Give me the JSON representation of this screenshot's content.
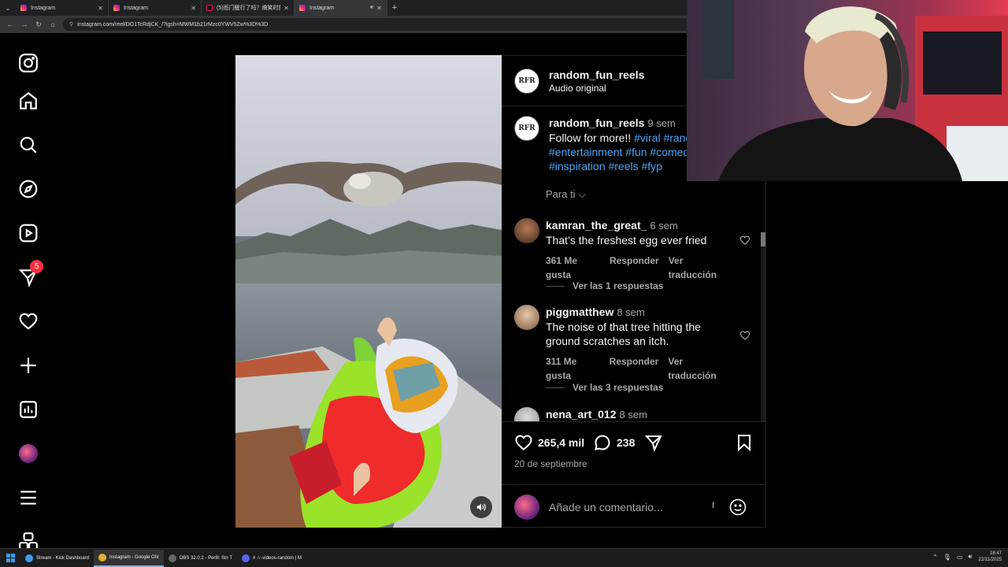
{
  "browser": {
    "tabs": [
      {
        "label": "Instagram",
        "favicon": "instagram-icon",
        "active": false
      },
      {
        "label": "Instagram",
        "favicon": "instagram-icon",
        "active": false
      },
      {
        "label": "(5)而门醒行了吗？搞笑时刻分",
        "favicon": "tiktok-icon",
        "active": false
      },
      {
        "label": "Instagram",
        "favicon": "instagram-icon",
        "active": true
      }
    ],
    "url": "instagram.com/reel/DO1TcRdjCK_/?igsh=MWM1b21rMzc0YWV5Zw%3D%3D"
  },
  "nav": {
    "notification_count": "5",
    "icons": [
      "instagram-logo-icon",
      "home-icon",
      "search-icon",
      "explore-icon",
      "reels-icon",
      "messages-icon",
      "notifications-icon",
      "create-icon",
      "dashboard-icon",
      "profile-avatar",
      "menu-icon",
      "more-apps-icon"
    ]
  },
  "post": {
    "username": "random_fun_reels",
    "audio": "Audio original",
    "avatar_text": "RFR",
    "caption": {
      "username": "random_fun_reels",
      "time": "9 sem",
      "text": "Follow for more!! ",
      "line1_tags": "#viral #rand",
      "line2_tags": "#entertainment #fun #comed",
      "line3_tags": "#inspiration #reels #fyp"
    },
    "sort_label": "Para ti",
    "likes": "265,4 mil",
    "comments_count": "238",
    "date": "20 de septiembre",
    "comment_placeholder": "Añade un comentario..."
  },
  "comments": [
    {
      "username": "kamran_the_great_",
      "time": "6 sem",
      "text": "That’s the freshest egg ever fried",
      "likes": "361 Me gusta",
      "reply": "Responder",
      "translate": "Ver traducción",
      "view_replies": "Ver las 1 respuestas"
    },
    {
      "username": "piggmatthew",
      "time": "8 sem",
      "text": "The noise of that tree hitting the ground scratches an itch.",
      "likes": "311 Me gusta",
      "reply": "Responder",
      "translate": "Ver traducción",
      "view_replies": "Ver las 3 respuestas"
    },
    {
      "username": "nena_art_012",
      "time": "8 sem",
      "text": ""
    }
  ],
  "taskbar": {
    "items": [
      {
        "label": "Stream - Kick Dashboard",
        "color": "#3b9cf0"
      },
      {
        "label": "Instagram - Google Chr",
        "color": "#e0b030"
      },
      {
        "label": "OBS 32.0.2 - Perfil: Sin T",
        "color": "#666666"
      },
      {
        "label": "# ☆-videos-random | M",
        "color": "#5865f2"
      }
    ],
    "time": "18:47",
    "date": "22/11/2025"
  },
  "colors": {
    "accent_link": "#4aa7f7",
    "badge": "#ff3040"
  }
}
